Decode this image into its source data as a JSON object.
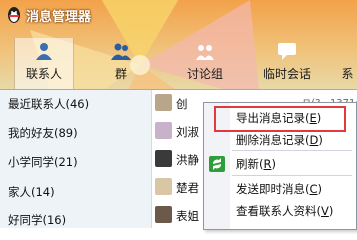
{
  "window": {
    "title": "消息管理器"
  },
  "tabs": [
    {
      "label": "联系人",
      "icon": "contacts-icon"
    },
    {
      "label": "群",
      "icon": "group-icon"
    },
    {
      "label": "讨论组",
      "icon": "discussion-group-icon"
    },
    {
      "label": "临时会话",
      "icon": "temp-chat-icon"
    },
    {
      "label": "系"
    }
  ],
  "groups": [
    {
      "label": "最近联系人(46)"
    },
    {
      "label": "我的好友(89)"
    },
    {
      "label": "小学同学(21)"
    },
    {
      "label": "家人(14)"
    },
    {
      "label": "好同学(16)"
    }
  ],
  "contacts": [
    {
      "name": "创",
      "extra": "ㅁ(?...1371:"
    },
    {
      "name": "刘淑"
    },
    {
      "name": "洪静"
    },
    {
      "name": "楚君"
    },
    {
      "name": "表姐"
    }
  ],
  "context_menu": {
    "items": [
      {
        "text": "导出消息记录",
        "key": "E"
      },
      {
        "text": "删除消息记录",
        "key": "D"
      },
      {
        "text": "刷新",
        "key": "R"
      },
      {
        "text": "发送即时消息",
        "key": "C"
      },
      {
        "text": "查看联系人资料",
        "key": "V"
      }
    ]
  },
  "colors": {
    "accent": "#f0a040",
    "highlight_border": "#e23a3a"
  }
}
